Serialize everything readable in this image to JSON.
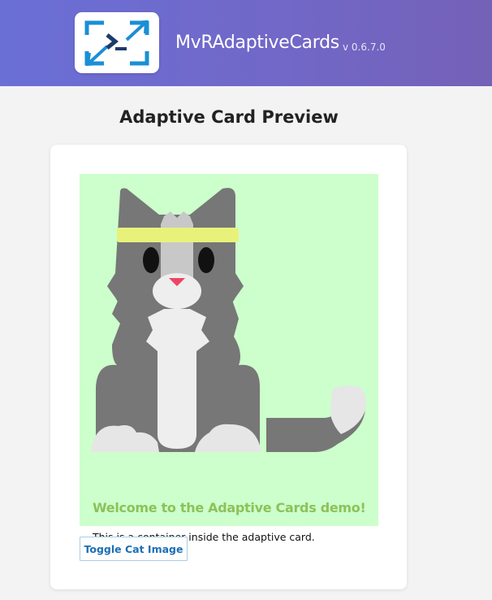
{
  "header": {
    "logo_icon": "powershell-terminal-icon",
    "app_name": "MvRAdaptiveCards",
    "version": "v 0.6.7.0",
    "gradient_colors": [
      "#6a6fd6",
      "#7461b8"
    ]
  },
  "page": {
    "title": "Adaptive Card Preview"
  },
  "card": {
    "container": {
      "background_color": "#ccffcc",
      "image": "cat-illustration",
      "heading": "Welcome to the Adaptive Cards demo!",
      "heading_color": "#8ec15a",
      "text": "This is a container inside the adaptive card."
    },
    "actions": {
      "toggle_label": "Toggle Cat Image"
    }
  }
}
